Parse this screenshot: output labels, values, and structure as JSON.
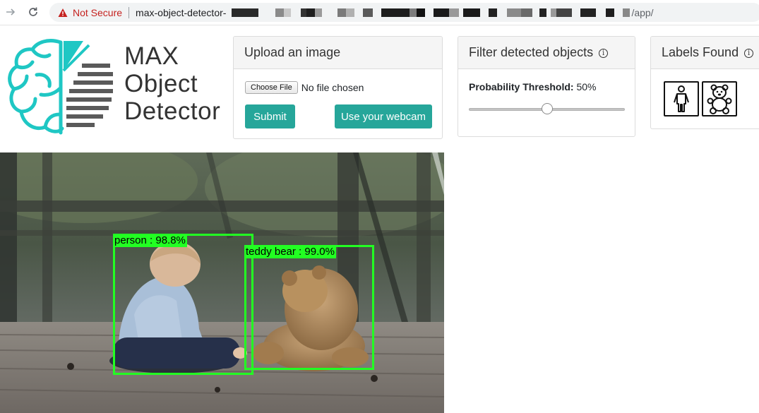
{
  "browser": {
    "security_label": "Not Secure",
    "host": "max-object-detector-",
    "path": "/app/"
  },
  "logo": {
    "line1": "MAX",
    "line2": "Object",
    "line3": "Detector"
  },
  "upload_card": {
    "title": "Upload an image",
    "choose_label": "Choose File",
    "file_status": "No file chosen",
    "submit_label": "Submit",
    "webcam_label": "Use your webcam"
  },
  "filter_card": {
    "title": "Filter detected objects",
    "threshold_label": "Probability Threshold:",
    "threshold_value": "50%",
    "threshold_fraction": 0.5,
    "info_glyph": "i"
  },
  "labels_card": {
    "title": "Labels Found",
    "info_glyph": "i",
    "labels": [
      {
        "name": "person",
        "icon": "person-icon"
      },
      {
        "name": "teddy bear",
        "icon": "teddy-bear-icon"
      }
    ]
  },
  "detections": [
    {
      "label": "person : 98.8%",
      "color": "#22ff22"
    },
    {
      "label": "teddy bear : 99.0%",
      "color": "#22ff22"
    }
  ],
  "colors": {
    "accent": "#26a69a",
    "logo_teal": "#1fc7c4",
    "logo_gray": "#5a5a5a",
    "detection_box": "#22ff22",
    "warning": "#c5221f"
  }
}
